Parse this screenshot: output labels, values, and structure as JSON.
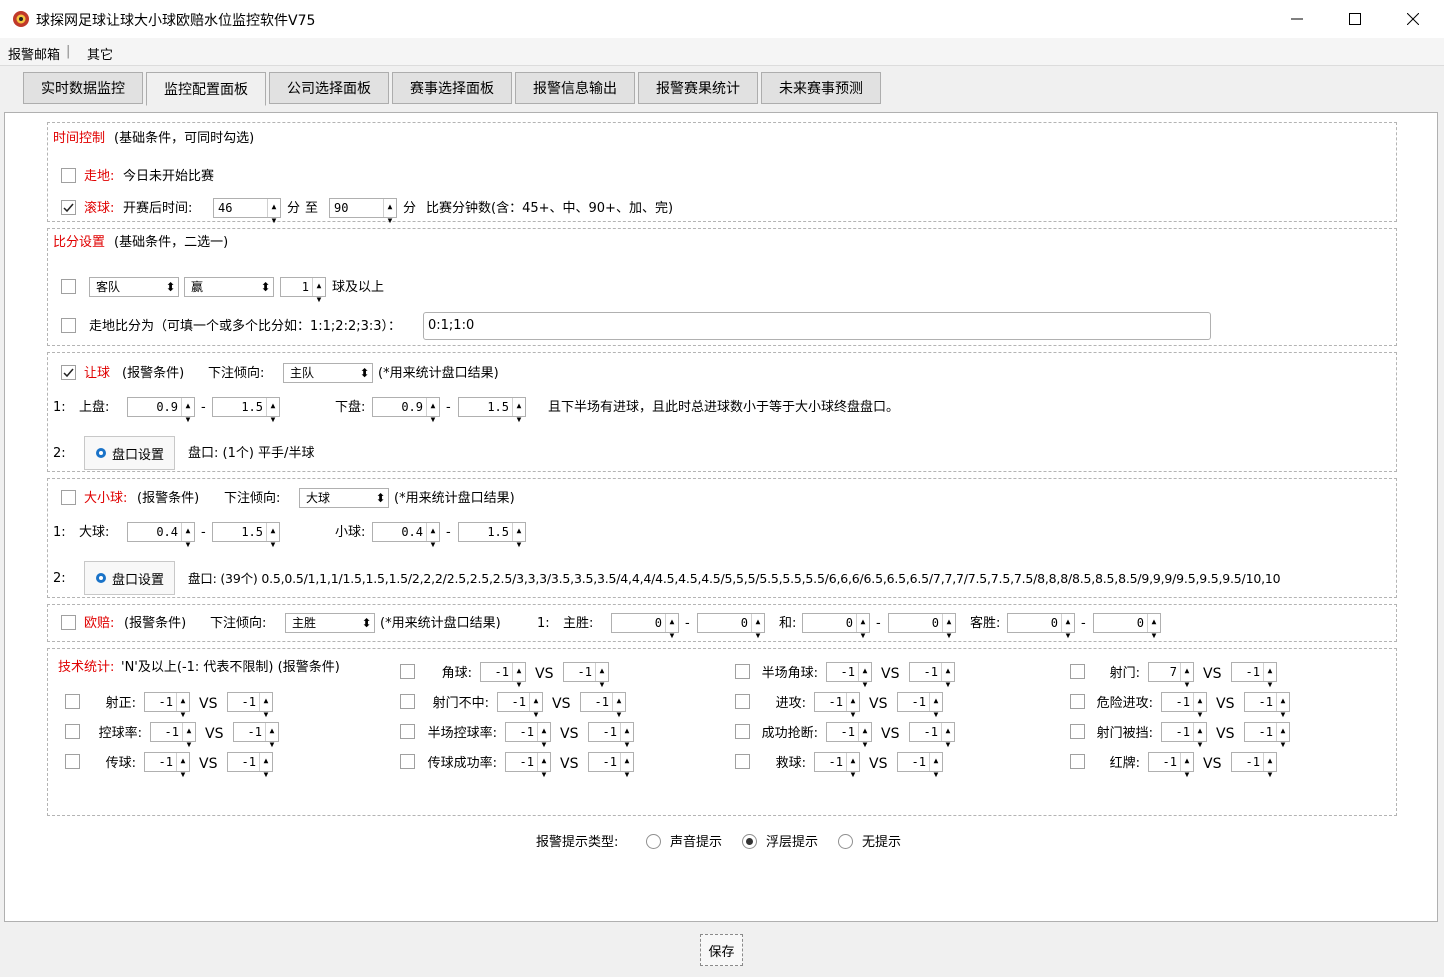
{
  "window": {
    "title": "球探网足球让球大小球欧赔水位监控软件V75"
  },
  "menu": {
    "alarm_mail": "报警邮箱",
    "sep": "|",
    "other": "其它"
  },
  "tabs": [
    "实时数据监控",
    "监控配置面板",
    "公司选择面板",
    "赛事选择面板",
    "报警信息输出",
    "报警赛果统计",
    "未来赛事预测"
  ],
  "time_ctrl": {
    "title": "时间控制",
    "note": "(基础条件，可同时勾选)",
    "zoudi_label": "走地:",
    "zoudi_text": "今日未开始比赛",
    "gunqiu_label": "滚球:",
    "gunqiu_text": "开赛后时间:",
    "from": "46",
    "fen": "分",
    "zhi": "至",
    "to": "90",
    "desc": "比赛分钟数(含：45+、中、90+、加、完)"
  },
  "score": {
    "title": "比分设置",
    "note": "(基础条件，二选一)",
    "team": "客队",
    "result": "赢",
    "goals": "1",
    "goals_suffix": "球及以上",
    "zoudi_label": "走地比分为（可填一个或多个比分如：1:1;2:2;3:3）：",
    "zoudi_value": "0:1;1:0"
  },
  "handicap": {
    "title": "让球",
    "note": "(报警条件)",
    "tend_label": "下注倾向:",
    "tend_value": "主队",
    "tend_note": "(*用来统计盘口结果)",
    "row1_num": "1:",
    "up_label": "上盘:",
    "up_min": "0.9",
    "up_max": "1.5",
    "down_label": "下盘:",
    "down_min": "0.9",
    "down_max": "1.5",
    "dash": "-",
    "cond": "且下半场有进球，且此时总进球数小于等于大小球终盘盘口。",
    "row2_num": "2:",
    "btn": "盘口设置",
    "pan": "盘口: (1个) 平手/半球"
  },
  "overunder": {
    "title": "大小球:",
    "note": "(报警条件)",
    "tend_label": "下注倾向:",
    "tend_value": "大球",
    "tend_note": "(*用来统计盘口结果)",
    "row1_num": "1:",
    "big_label": "大球:",
    "big_min": "0.4",
    "big_max": "1.5",
    "small_label": "小球:",
    "small_min": "0.4",
    "small_max": "1.5",
    "dash": "-",
    "row2_num": "2:",
    "btn": "盘口设置",
    "pan": "盘口: (39个) 0.5,0.5/1,1,1/1.5,1.5,1.5/2,2,2/2.5,2.5,2.5/3,3,3/3.5,3.5,3.5/4,4,4/4.5,4.5,4.5/5,5,5/5.5,5.5,5.5/6,6,6/6.5,6.5,6.5/7,7,7/7.5,7.5,7.5/8,8,8/8.5,8.5,8.5/9,9,9/9.5,9.5,9.5/10,10"
  },
  "euro": {
    "title": "欧赔:",
    "note": "(报警条件)",
    "tend_label": "下注倾向:",
    "tend_value": "主胜",
    "tend_note": "(*用来统计盘口结果)",
    "num": "1:",
    "home_label": "主胜:",
    "draw_label": "和:",
    "away_label": "客胜:",
    "dash": "-",
    "home_min": "0",
    "home_max": "0",
    "draw_min": "0",
    "draw_max": "0",
    "away_min": "0",
    "away_max": "0"
  },
  "tech": {
    "title": "技术统计:",
    "note": "'N'及以上(-1: 代表不限制) (报警条件)",
    "vs": "VS",
    "items": [
      {
        "label": "角球:",
        "a": "-1",
        "b": "-1"
      },
      {
        "label": "半场角球:",
        "a": "-1",
        "b": "-1"
      },
      {
        "label": "射门:",
        "a": "7",
        "b": "-1"
      },
      {
        "label": "射正:",
        "a": "-1",
        "b": "-1"
      },
      {
        "label": "射门不中:",
        "a": "-1",
        "b": "-1"
      },
      {
        "label": "进攻:",
        "a": "-1",
        "b": "-1"
      },
      {
        "label": "危险进攻:",
        "a": "-1",
        "b": "-1"
      },
      {
        "label": "控球率:",
        "a": "-1",
        "b": "-1"
      },
      {
        "label": "半场控球率:",
        "a": "-1",
        "b": "-1"
      },
      {
        "label": "成功抢断:",
        "a": "-1",
        "b": "-1"
      },
      {
        "label": "射门被挡:",
        "a": "-1",
        "b": "-1"
      },
      {
        "label": "传球:",
        "a": "-1",
        "b": "-1"
      },
      {
        "label": "传球成功率:",
        "a": "-1",
        "b": "-1"
      },
      {
        "label": "救球:",
        "a": "-1",
        "b": "-1"
      },
      {
        "label": "红牌:",
        "a": "-1",
        "b": "-1"
      }
    ]
  },
  "alert": {
    "label": "报警提示类型:",
    "opt1": "声音提示",
    "opt2": "浮层提示",
    "opt3": "无提示"
  },
  "save": "保存",
  "colors": {
    "accent_red": "#e00000",
    "gear_blue": "#1a73c8"
  }
}
